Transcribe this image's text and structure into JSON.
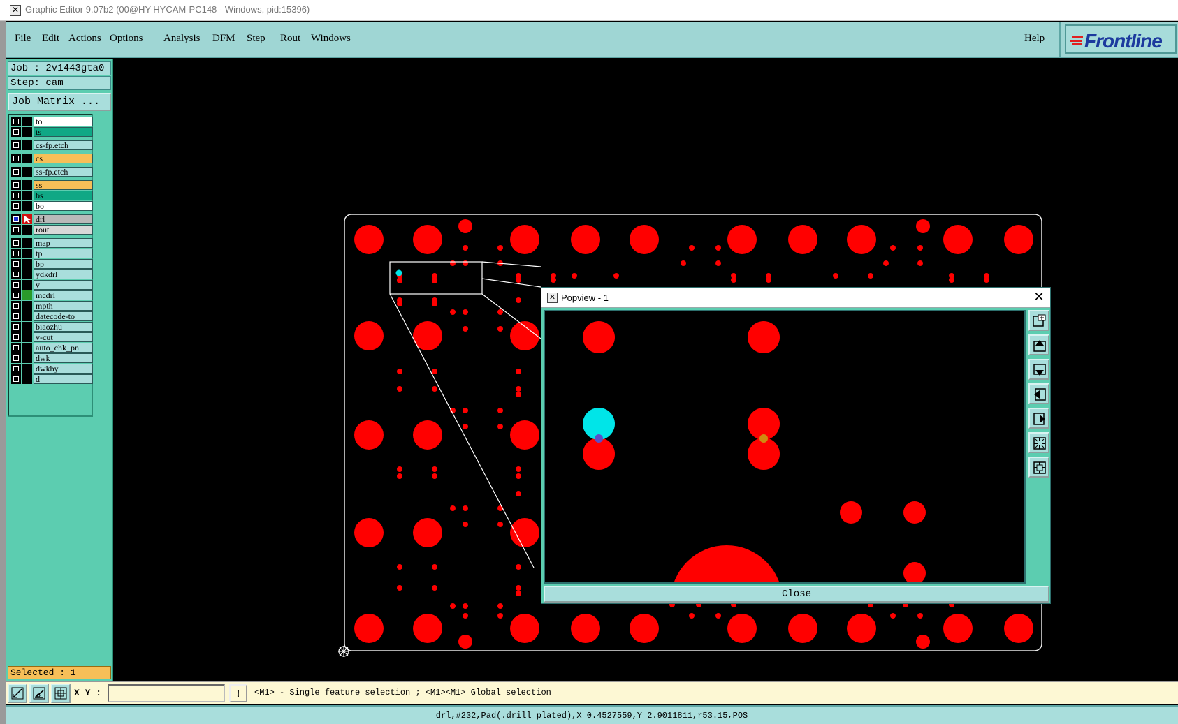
{
  "window": {
    "title": "Graphic Editor 9.07b2 (00@HY-HYCAM-PC148 - Windows, pid:15396)"
  },
  "menu": {
    "items": [
      "File",
      "Edit",
      "Actions",
      "Options",
      "Analysis",
      "DFM",
      "Step",
      "Rout",
      "Windows"
    ],
    "help": "Help",
    "logo": "Frontline"
  },
  "job": {
    "job_label": "Job : 2v1443gta0",
    "step_label": "Step: cam",
    "matrix_button": "Job Matrix ..."
  },
  "layers": [
    {
      "name": "to",
      "color": "#ffffff"
    },
    {
      "name": "ts",
      "color": "#10a885"
    },
    {
      "name": "cs-fp.etch",
      "color": "#a9dedc"
    },
    {
      "name": "cs",
      "color": "#f7bf58"
    },
    {
      "name": "ss-fp.etch",
      "color": "#a9dedc"
    },
    {
      "name": "ss",
      "color": "#f7bf58"
    },
    {
      "name": "bs",
      "color": "#10a885"
    },
    {
      "name": "bo",
      "color": "#ffffff"
    },
    {
      "name": "drl",
      "color": "#b9b9b9",
      "active": true
    },
    {
      "name": "rout",
      "color": "#d8d8d8"
    },
    {
      "name": "map",
      "color": "#a9dedc"
    },
    {
      "name": "tp",
      "color": "#a9dedc"
    },
    {
      "name": "bp",
      "color": "#a9dedc"
    },
    {
      "name": "ydkdrl",
      "color": "#a9dedc"
    },
    {
      "name": "v",
      "color": "#a9dedc"
    },
    {
      "name": "mcdrl",
      "color": "#a9dedc",
      "mark": "#2a9a2a"
    },
    {
      "name": "mpth",
      "color": "#a9dedc"
    },
    {
      "name": "datecode-to",
      "color": "#a9dedc"
    },
    {
      "name": "biaozhu",
      "color": "#a9dedc"
    },
    {
      "name": "v-cut",
      "color": "#a9dedc"
    },
    {
      "name": "auto_chk_pn",
      "color": "#a9dedc"
    },
    {
      "name": "dwk",
      "color": "#a9dedc"
    },
    {
      "name": "dwkby",
      "color": "#a9dedc"
    },
    {
      "name": "d",
      "color": "#a9dedc"
    }
  ],
  "selected": "Selected : 1",
  "popview": {
    "title": "Popview - 1",
    "close_label": "Close",
    "buttons": [
      "zoom-window-icon",
      "pan-up-icon",
      "pan-down-icon",
      "pan-left-icon",
      "pan-right-icon",
      "zoom-out-icon",
      "zoom-in-icon"
    ]
  },
  "bottom": {
    "xy_label": "X Y :",
    "xy_value": "",
    "warn": "!",
    "hint": "<M1> - Single feature selection ; <M1><M1> Global selection"
  },
  "status": "drl,#232,Pad(.drill=plated),X=0.4527559,Y=2.9011811,r53.15,POS",
  "colors": {
    "pad": "#ff0000",
    "selected_pad": "#00e5e8",
    "panel": "#5ccdb0",
    "menu": "#9fd6d4"
  }
}
